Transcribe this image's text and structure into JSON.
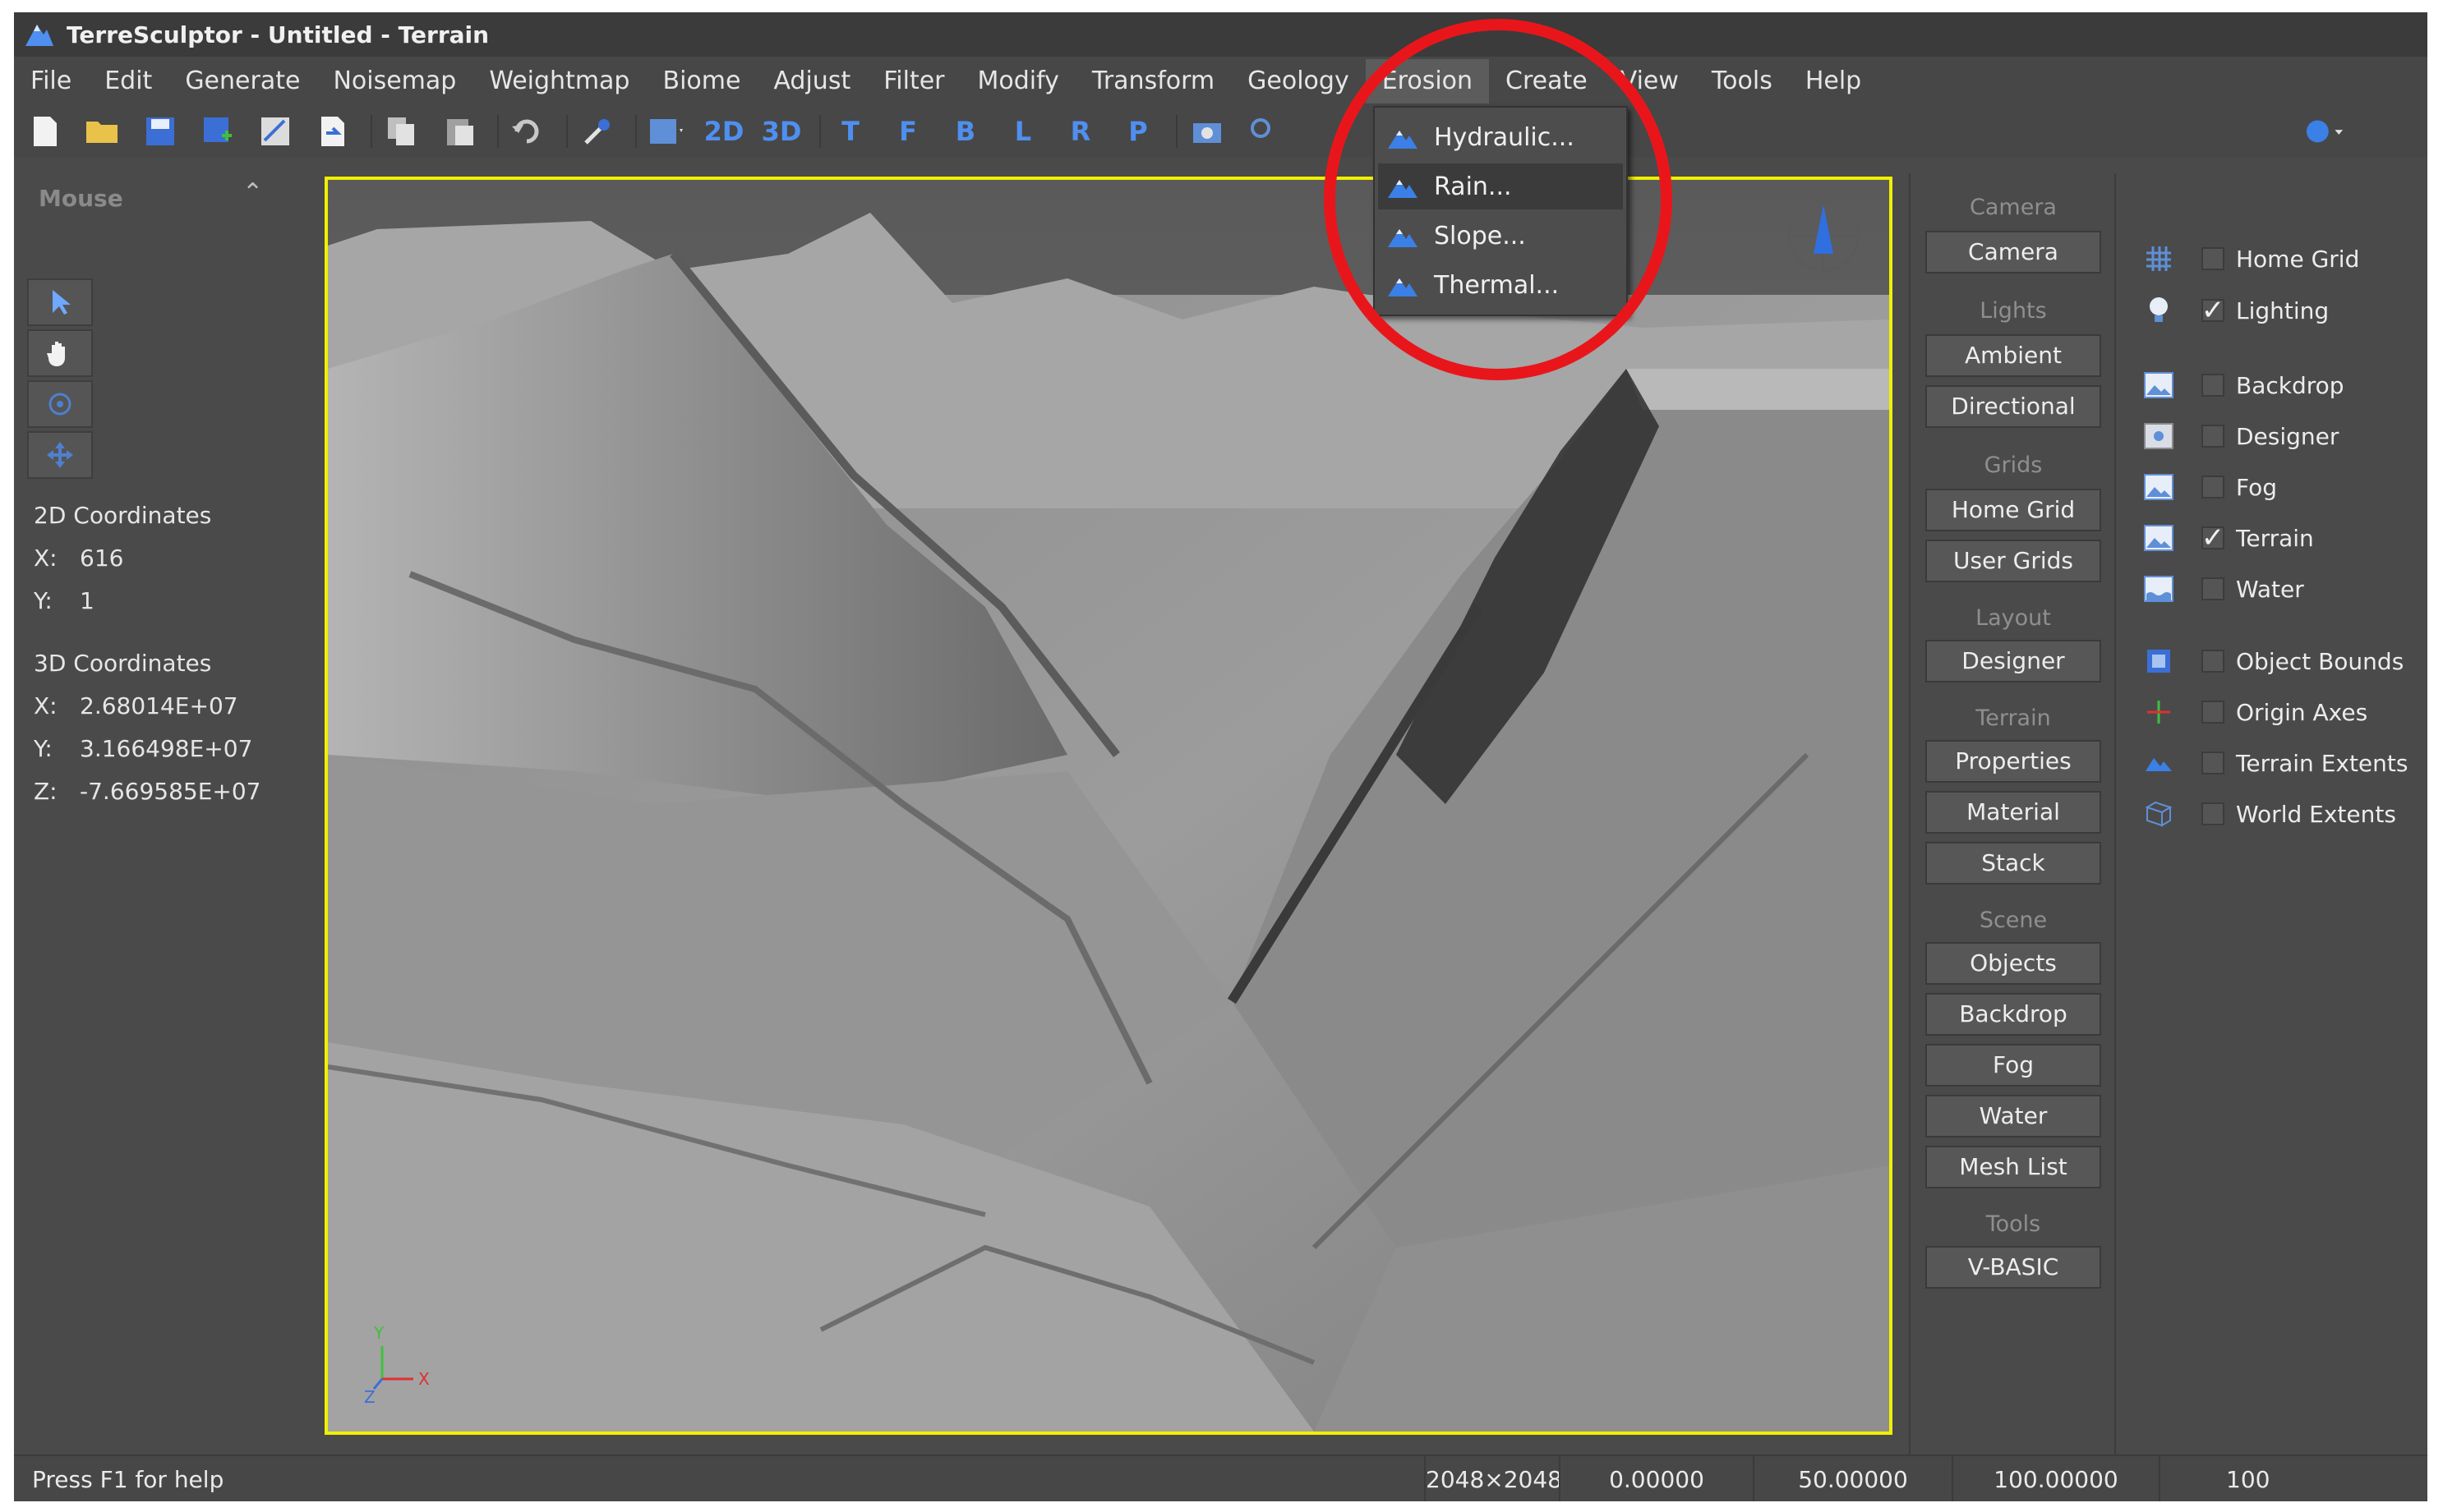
{
  "window": {
    "title": "TerreSculptor - Untitled - Terrain"
  },
  "menubar": {
    "items": [
      "File",
      "Edit",
      "Generate",
      "Noisemap",
      "Weightmap",
      "Biome",
      "Adjust",
      "Filter",
      "Modify",
      "Transform",
      "Geology",
      "Erosion",
      "Create",
      "View",
      "Tools",
      "Help"
    ],
    "open_menu": "Erosion"
  },
  "toolbar": {
    "view_2d": "2D",
    "view_3d": "3D",
    "views": [
      "T",
      "F",
      "B",
      "L",
      "R",
      "P"
    ]
  },
  "erosion_menu": {
    "items": [
      "Hydraulic...",
      "Rain...",
      "Slope...",
      "Thermal..."
    ],
    "highlighted": "Rain..."
  },
  "left_panel": {
    "header": "Mouse",
    "coords2d": {
      "title": "2D Coordinates",
      "x_label": "X:",
      "x": "616",
      "y_label": "Y:",
      "y": "1"
    },
    "coords3d": {
      "title": "3D Coordinates",
      "x_label": "X:",
      "x": "2.68014E+07",
      "y_label": "Y:",
      "y": "3.166498E+07",
      "z_label": "Z:",
      "z": "-7.669585E+07"
    }
  },
  "viewport": {
    "axes": {
      "x": "X",
      "y": "Y",
      "z": "Z"
    }
  },
  "right_panel": {
    "camera_label": "Camera",
    "camera_btn": "Camera",
    "lights_label": "Lights",
    "ambient": "Ambient",
    "directional": "Directional",
    "grids_label": "Grids",
    "home_grid": "Home Grid",
    "user_grids": "User Grids",
    "layout_label": "Layout",
    "designer": "Designer",
    "terrain_label": "Terrain",
    "properties": "Properties",
    "material": "Material",
    "stack": "Stack",
    "scene_label": "Scene",
    "objects": "Objects",
    "backdrop": "Backdrop",
    "fog": "Fog",
    "water": "Water",
    "mesh_list": "Mesh List",
    "tools_label": "Tools",
    "vbasic": "V-BASIC"
  },
  "options": [
    {
      "label": "Home Grid",
      "checked": false,
      "icon": "grid-icon"
    },
    {
      "label": "Lighting",
      "checked": true,
      "icon": "bulb-icon"
    },
    {
      "label": "Backdrop",
      "checked": false,
      "icon": "image-icon"
    },
    {
      "label": "Designer",
      "checked": false,
      "icon": "designer-icon"
    },
    {
      "label": "Fog",
      "checked": false,
      "icon": "image-icon"
    },
    {
      "label": "Terrain",
      "checked": true,
      "icon": "image-icon"
    },
    {
      "label": "Water",
      "checked": false,
      "icon": "image-icon"
    },
    {
      "label": "Object Bounds",
      "checked": false,
      "icon": "bounds-icon"
    },
    {
      "label": "Origin Axes",
      "checked": false,
      "icon": "axes-icon"
    },
    {
      "label": "Terrain Extents",
      "checked": false,
      "icon": "terrain-icon"
    },
    {
      "label": "World Extents",
      "checked": false,
      "icon": "world-icon"
    }
  ],
  "statusbar": {
    "help": "Press F1 for help",
    "size": "2048×2048",
    "v1": "0.00000",
    "v2": "50.00000",
    "v3": "100.00000",
    "v4": "100"
  },
  "colors": {
    "accent": "#4f8ff0",
    "viewport_border": "#f0f000",
    "annotation": "#e8161b"
  }
}
